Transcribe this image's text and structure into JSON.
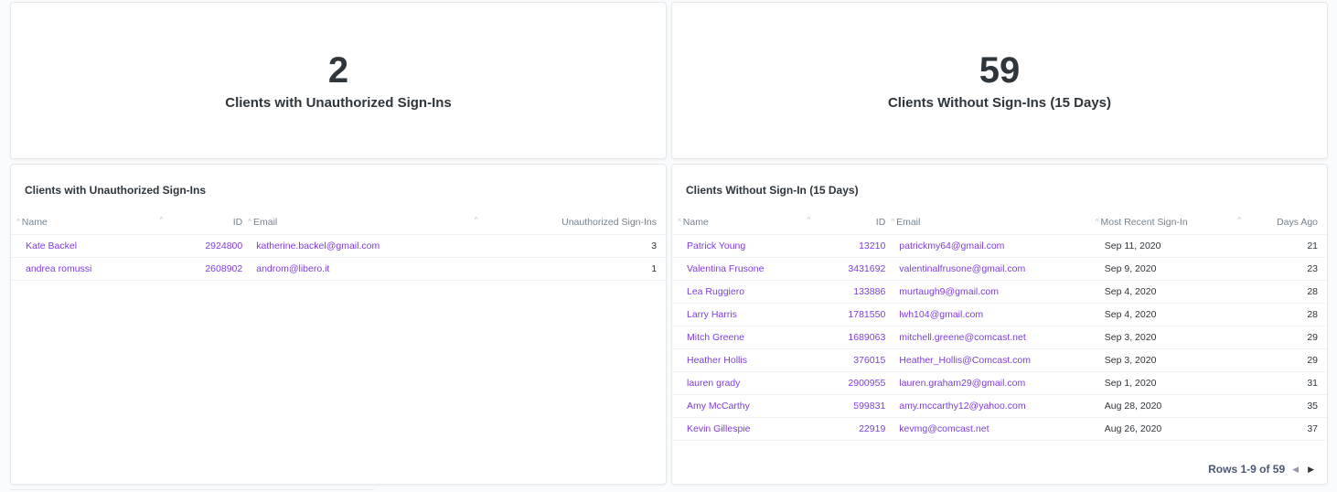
{
  "stat_left": {
    "value": "2",
    "label": "Clients with Unauthorized Sign-Ins"
  },
  "stat_right": {
    "value": "59",
    "label": "Clients Without Sign-Ins (15 Days)"
  },
  "table_left": {
    "title": "Clients with Unauthorized Sign-Ins",
    "columns": {
      "name": "Name",
      "id": "ID",
      "email": "Email",
      "count": "Unauthorized Sign-Ins"
    },
    "rows": [
      {
        "name": "Kate Backel",
        "id": "2924800",
        "email": "katherine.backel@gmail.com",
        "count": "3"
      },
      {
        "name": "andrea romussi",
        "id": "2608902",
        "email": "androm@libero.it",
        "count": "1"
      }
    ]
  },
  "table_right": {
    "title": "Clients Without Sign-In (15 Days)",
    "columns": {
      "name": "Name",
      "id": "ID",
      "email": "Email",
      "recent": "Most Recent Sign-In",
      "days": "Days Ago"
    },
    "rows": [
      {
        "name": "Patrick Young",
        "id": "13210",
        "email": "patrickmy64@gmail.com",
        "recent": "Sep 11, 2020",
        "days": "21"
      },
      {
        "name": "Valentina Frusone",
        "id": "3431692",
        "email": "valentinalfrusone@gmail.com",
        "recent": "Sep 9, 2020",
        "days": "23"
      },
      {
        "name": "Lea Ruggiero",
        "id": "133886",
        "email": "murtaugh9@gmail.com",
        "recent": "Sep 4, 2020",
        "days": "28"
      },
      {
        "name": "Larry Harris",
        "id": "1781550",
        "email": "lwh104@gmail.com",
        "recent": "Sep 4, 2020",
        "days": "28"
      },
      {
        "name": "Mitch Greene",
        "id": "1689063",
        "email": "mitchell.greene@comcast.net",
        "recent": "Sep 3, 2020",
        "days": "29"
      },
      {
        "name": "Heather Hollis",
        "id": "376015",
        "email": "Heather_Hollis@Comcast.com",
        "recent": "Sep 3, 2020",
        "days": "29"
      },
      {
        "name": "lauren grady",
        "id": "2900955",
        "email": "lauren.graham29@gmail.com",
        "recent": "Sep 1, 2020",
        "days": "31"
      },
      {
        "name": "Amy McCarthy",
        "id": "599831",
        "email": "amy.mccarthy12@yahoo.com",
        "recent": "Aug 28, 2020",
        "days": "35"
      },
      {
        "name": "Kevin Gillespie",
        "id": "22919",
        "email": "kevmg@comcast.net",
        "recent": "Aug 26, 2020",
        "days": "37"
      }
    ],
    "pagination": "Rows 1-9 of 59"
  },
  "icons": {
    "sort": "sort-caret-icon",
    "prev": "chevron-left-icon",
    "next": "chevron-right-icon"
  },
  "colors": {
    "link": "#7f3ce1",
    "text": "#2e353b",
    "muted": "#74838f"
  }
}
